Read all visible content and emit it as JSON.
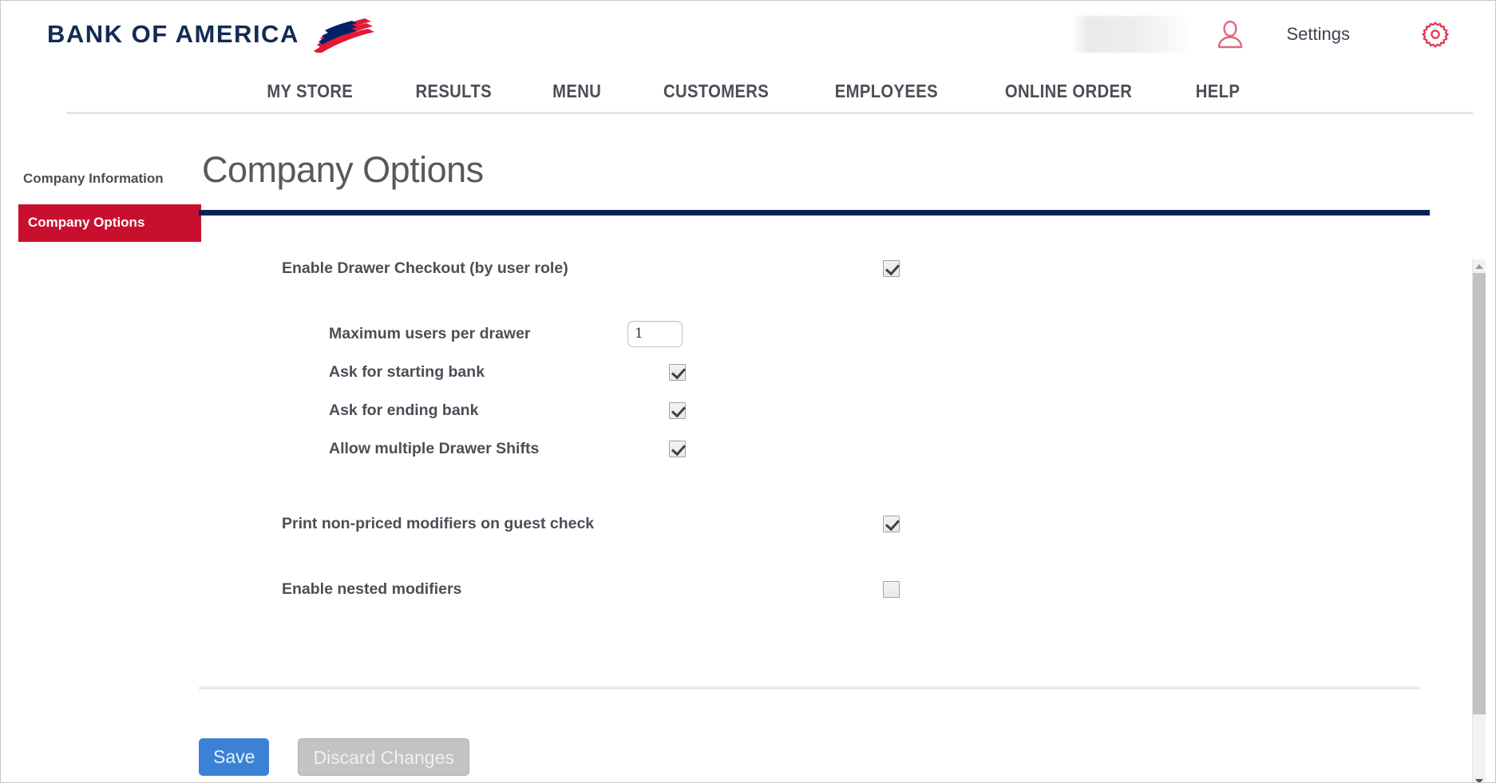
{
  "header": {
    "brand": "BANK OF AMERICA",
    "brand_icon": "bofa-flag-logo",
    "user_badge_redacted": "",
    "person_icon": "person-icon",
    "settings_label": "Settings",
    "gear_icon": "gear-icon",
    "colors": {
      "brand_navy": "#122b54",
      "brand_red": "#e31837",
      "accent_crimson": "#c8102e",
      "rule_navy": "#0a2058",
      "save_blue": "#3b82d6"
    }
  },
  "nav": {
    "items": [
      {
        "label": "MY STORE"
      },
      {
        "label": "RESULTS"
      },
      {
        "label": "MENU"
      },
      {
        "label": "CUSTOMERS"
      },
      {
        "label": "EMPLOYEES"
      },
      {
        "label": "ONLINE ORDER"
      },
      {
        "label": "HELP"
      }
    ]
  },
  "sidebar": {
    "items": [
      {
        "label": "Company Information",
        "active": false
      },
      {
        "label": "Company Options",
        "active": true
      }
    ]
  },
  "main": {
    "title": "Company Options",
    "options": [
      {
        "label": "Enable Drawer Checkout (by user role)",
        "type": "checkbox",
        "checked": true,
        "indent": 0
      },
      {
        "label": "Maximum users per drawer",
        "type": "number",
        "value": "1",
        "indent": 1
      },
      {
        "label": "Ask for starting bank",
        "type": "checkbox",
        "checked": true,
        "indent": 1
      },
      {
        "label": "Ask for ending bank",
        "type": "checkbox",
        "checked": true,
        "indent": 1
      },
      {
        "label": "Allow multiple Drawer Shifts",
        "type": "checkbox",
        "checked": true,
        "indent": 1
      },
      {
        "label": "Print non-priced modifiers on guest check",
        "type": "checkbox",
        "checked": true,
        "indent": 0
      },
      {
        "label": "Enable nested modifiers",
        "type": "checkbox",
        "checked": false,
        "indent": 0
      }
    ],
    "buttons": {
      "save": "Save",
      "discard": "Discard Changes"
    }
  }
}
